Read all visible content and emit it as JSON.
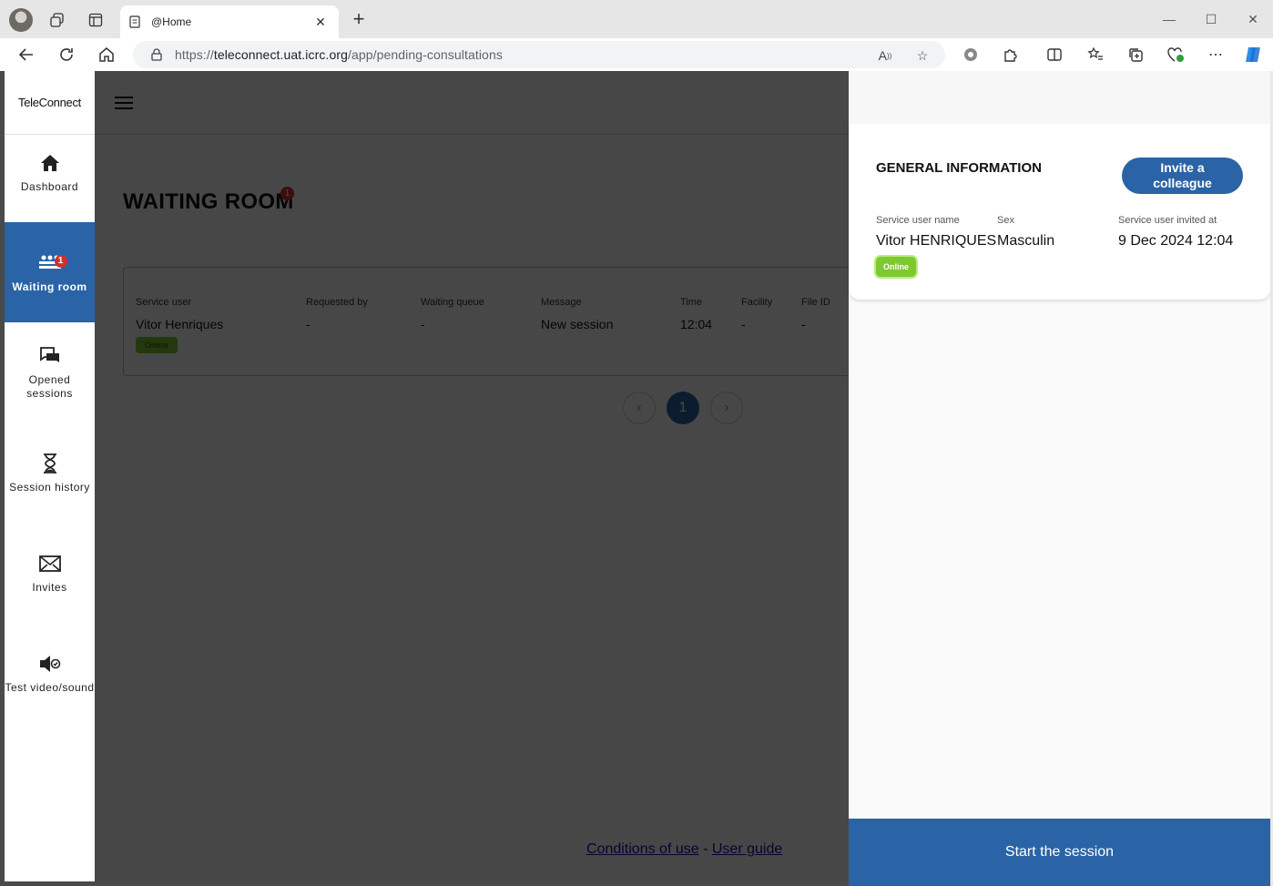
{
  "browser": {
    "tab_title": "@Home",
    "url_prefix": "https://",
    "url_host": "teleconnect.uat.icrc.org",
    "url_path": "/app/pending-consultations"
  },
  "sidebar": {
    "brand": "TeleConnect",
    "items": [
      {
        "label": "Dashboard",
        "icon": "home-icon"
      },
      {
        "label": "Waiting room",
        "icon": "people-icon",
        "badge": "1"
      },
      {
        "label": "Opened sessions",
        "icon": "chat-icon"
      },
      {
        "label": "Session history",
        "icon": "hourglass-icon"
      },
      {
        "label": "Invites",
        "icon": "envelope-icon"
      },
      {
        "label": "Test video/sound",
        "icon": "speaker-icon"
      }
    ]
  },
  "main": {
    "title": "WAITING ROOM",
    "title_badge": "1",
    "columns": [
      "Service user",
      "Requested by",
      "Waiting queue",
      "Message",
      "Time",
      "Facility",
      "File ID"
    ],
    "row": {
      "service_user": "Vitor Henriques",
      "status": "Online",
      "requested_by": "-",
      "waiting_queue": "-",
      "message": "New session",
      "time": "12:04",
      "facility": "-",
      "file_id": "-"
    },
    "pagination": {
      "current": "1",
      "prev": "‹",
      "next": "›"
    },
    "footer": {
      "conditions": "Conditions of use",
      "separator": "-",
      "guide": "User guide"
    }
  },
  "panel": {
    "title": "GENERAL INFORMATION",
    "invite_button": "Invite a colleague",
    "fields": {
      "name_label": "Service user name",
      "name_value": "Vitor HENRIQUES",
      "sex_label": "Sex",
      "sex_value": "Masculin",
      "invited_label": "Service user invited at",
      "invited_value": "9 Dec 2024 12:04"
    },
    "status": "Online",
    "start_button": "Start the session"
  },
  "colors": {
    "accent": "#2a64a6",
    "badge": "#d32f2f",
    "online": "#7ec832"
  }
}
